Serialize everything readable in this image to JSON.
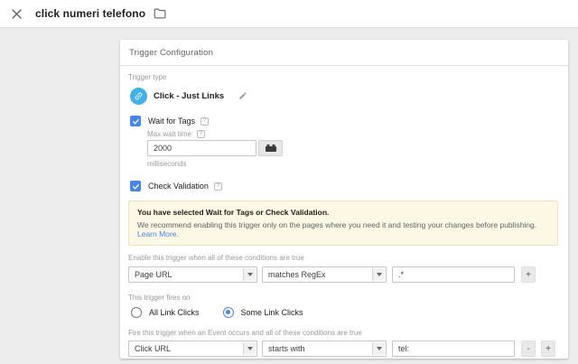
{
  "colors": {
    "accent_blue": "#4285f4",
    "trigger_icon_blue": "#3eb0f0",
    "notice_bg": "#fcf8e3",
    "notice_border": "#ece4bd",
    "page_bg": "#ededed"
  },
  "topbar": {
    "title": "click numeri telefono",
    "close_icon": "close-x",
    "folder_icon": "folder-outline"
  },
  "panel": {
    "title": "Trigger Configuration",
    "trigger_type": {
      "label": "Trigger type",
      "value": "Click - Just Links",
      "icon": "link-icon",
      "edit_icon": "pencil"
    },
    "wait_for_tags": {
      "label": "Wait for Tags",
      "help": "?",
      "max_wait": {
        "label": "Max wait time",
        "help": "?",
        "value": "2000",
        "unit": "milliseconds",
        "picker_icon": "brick-variable-picker"
      }
    },
    "check_validation": {
      "label": "Check Validation",
      "help": "?"
    },
    "notice": {
      "title": "You have selected Wait for Tags or Check Validation.",
      "body": "We recommend enabling this trigger only on the pages where you need it and testing your changes before publishing.",
      "link": "Learn More."
    },
    "enable_section": {
      "label": "Enable this trigger when all of these conditions are true",
      "variable": "Page URL",
      "operator": "matches RegEx",
      "value": ".*",
      "add_label": "+"
    },
    "fires_on": {
      "label": "This trigger fires on",
      "options": [
        {
          "label": "All Link Clicks",
          "selected": false
        },
        {
          "label": "Some Link Clicks",
          "selected": true
        }
      ]
    },
    "fire_section": {
      "label": "Fire this trigger when an Event occurs and all of these conditions are true",
      "variable": "Click URL",
      "operator": "starts with",
      "value": "tel:",
      "remove_label": "-",
      "add_label": "+"
    }
  }
}
